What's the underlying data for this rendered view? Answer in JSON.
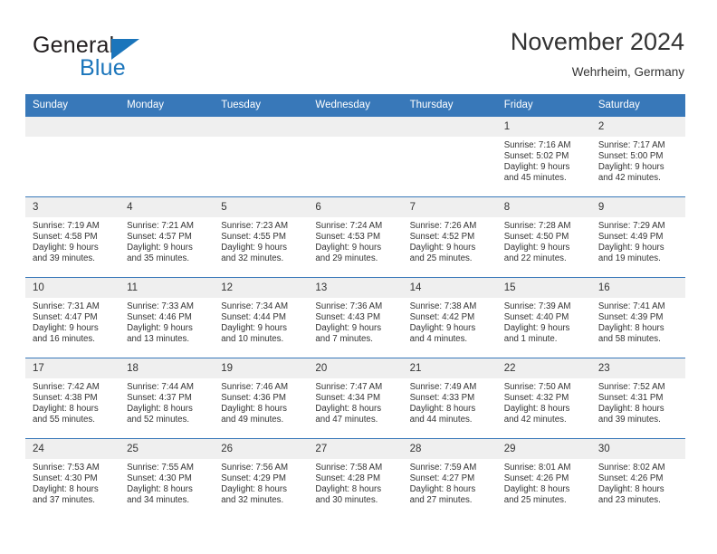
{
  "brand": {
    "name_part1": "General",
    "name_part2": "Blue",
    "accent_color": "#1b75bb",
    "logo_icon": "triangle-flag-icon"
  },
  "header": {
    "title": "November 2024",
    "subtitle": "Wehrheim, Germany",
    "header_bg_color": "#3878b9",
    "daynum_bg_color": "#efefef"
  },
  "weekday_headers": [
    "Sunday",
    "Monday",
    "Tuesday",
    "Wednesday",
    "Thursday",
    "Friday",
    "Saturday"
  ],
  "weeks": [
    [
      {
        "day": "",
        "lines": []
      },
      {
        "day": "",
        "lines": []
      },
      {
        "day": "",
        "lines": []
      },
      {
        "day": "",
        "lines": []
      },
      {
        "day": "",
        "lines": []
      },
      {
        "day": "1",
        "lines": [
          "Sunrise: 7:16 AM",
          "Sunset: 5:02 PM",
          "Daylight: 9 hours",
          "and 45 minutes."
        ]
      },
      {
        "day": "2",
        "lines": [
          "Sunrise: 7:17 AM",
          "Sunset: 5:00 PM",
          "Daylight: 9 hours",
          "and 42 minutes."
        ]
      }
    ],
    [
      {
        "day": "3",
        "lines": [
          "Sunrise: 7:19 AM",
          "Sunset: 4:58 PM",
          "Daylight: 9 hours",
          "and 39 minutes."
        ]
      },
      {
        "day": "4",
        "lines": [
          "Sunrise: 7:21 AM",
          "Sunset: 4:57 PM",
          "Daylight: 9 hours",
          "and 35 minutes."
        ]
      },
      {
        "day": "5",
        "lines": [
          "Sunrise: 7:23 AM",
          "Sunset: 4:55 PM",
          "Daylight: 9 hours",
          "and 32 minutes."
        ]
      },
      {
        "day": "6",
        "lines": [
          "Sunrise: 7:24 AM",
          "Sunset: 4:53 PM",
          "Daylight: 9 hours",
          "and 29 minutes."
        ]
      },
      {
        "day": "7",
        "lines": [
          "Sunrise: 7:26 AM",
          "Sunset: 4:52 PM",
          "Daylight: 9 hours",
          "and 25 minutes."
        ]
      },
      {
        "day": "8",
        "lines": [
          "Sunrise: 7:28 AM",
          "Sunset: 4:50 PM",
          "Daylight: 9 hours",
          "and 22 minutes."
        ]
      },
      {
        "day": "9",
        "lines": [
          "Sunrise: 7:29 AM",
          "Sunset: 4:49 PM",
          "Daylight: 9 hours",
          "and 19 minutes."
        ]
      }
    ],
    [
      {
        "day": "10",
        "lines": [
          "Sunrise: 7:31 AM",
          "Sunset: 4:47 PM",
          "Daylight: 9 hours",
          "and 16 minutes."
        ]
      },
      {
        "day": "11",
        "lines": [
          "Sunrise: 7:33 AM",
          "Sunset: 4:46 PM",
          "Daylight: 9 hours",
          "and 13 minutes."
        ]
      },
      {
        "day": "12",
        "lines": [
          "Sunrise: 7:34 AM",
          "Sunset: 4:44 PM",
          "Daylight: 9 hours",
          "and 10 minutes."
        ]
      },
      {
        "day": "13",
        "lines": [
          "Sunrise: 7:36 AM",
          "Sunset: 4:43 PM",
          "Daylight: 9 hours",
          "and 7 minutes."
        ]
      },
      {
        "day": "14",
        "lines": [
          "Sunrise: 7:38 AM",
          "Sunset: 4:42 PM",
          "Daylight: 9 hours",
          "and 4 minutes."
        ]
      },
      {
        "day": "15",
        "lines": [
          "Sunrise: 7:39 AM",
          "Sunset: 4:40 PM",
          "Daylight: 9 hours",
          "and 1 minute."
        ]
      },
      {
        "day": "16",
        "lines": [
          "Sunrise: 7:41 AM",
          "Sunset: 4:39 PM",
          "Daylight: 8 hours",
          "and 58 minutes."
        ]
      }
    ],
    [
      {
        "day": "17",
        "lines": [
          "Sunrise: 7:42 AM",
          "Sunset: 4:38 PM",
          "Daylight: 8 hours",
          "and 55 minutes."
        ]
      },
      {
        "day": "18",
        "lines": [
          "Sunrise: 7:44 AM",
          "Sunset: 4:37 PM",
          "Daylight: 8 hours",
          "and 52 minutes."
        ]
      },
      {
        "day": "19",
        "lines": [
          "Sunrise: 7:46 AM",
          "Sunset: 4:36 PM",
          "Daylight: 8 hours",
          "and 49 minutes."
        ]
      },
      {
        "day": "20",
        "lines": [
          "Sunrise: 7:47 AM",
          "Sunset: 4:34 PM",
          "Daylight: 8 hours",
          "and 47 minutes."
        ]
      },
      {
        "day": "21",
        "lines": [
          "Sunrise: 7:49 AM",
          "Sunset: 4:33 PM",
          "Daylight: 8 hours",
          "and 44 minutes."
        ]
      },
      {
        "day": "22",
        "lines": [
          "Sunrise: 7:50 AM",
          "Sunset: 4:32 PM",
          "Daylight: 8 hours",
          "and 42 minutes."
        ]
      },
      {
        "day": "23",
        "lines": [
          "Sunrise: 7:52 AM",
          "Sunset: 4:31 PM",
          "Daylight: 8 hours",
          "and 39 minutes."
        ]
      }
    ],
    [
      {
        "day": "24",
        "lines": [
          "Sunrise: 7:53 AM",
          "Sunset: 4:30 PM",
          "Daylight: 8 hours",
          "and 37 minutes."
        ]
      },
      {
        "day": "25",
        "lines": [
          "Sunrise: 7:55 AM",
          "Sunset: 4:30 PM",
          "Daylight: 8 hours",
          "and 34 minutes."
        ]
      },
      {
        "day": "26",
        "lines": [
          "Sunrise: 7:56 AM",
          "Sunset: 4:29 PM",
          "Daylight: 8 hours",
          "and 32 minutes."
        ]
      },
      {
        "day": "27",
        "lines": [
          "Sunrise: 7:58 AM",
          "Sunset: 4:28 PM",
          "Daylight: 8 hours",
          "and 30 minutes."
        ]
      },
      {
        "day": "28",
        "lines": [
          "Sunrise: 7:59 AM",
          "Sunset: 4:27 PM",
          "Daylight: 8 hours",
          "and 27 minutes."
        ]
      },
      {
        "day": "29",
        "lines": [
          "Sunrise: 8:01 AM",
          "Sunset: 4:26 PM",
          "Daylight: 8 hours",
          "and 25 minutes."
        ]
      },
      {
        "day": "30",
        "lines": [
          "Sunrise: 8:02 AM",
          "Sunset: 4:26 PM",
          "Daylight: 8 hours",
          "and 23 minutes."
        ]
      }
    ]
  ]
}
